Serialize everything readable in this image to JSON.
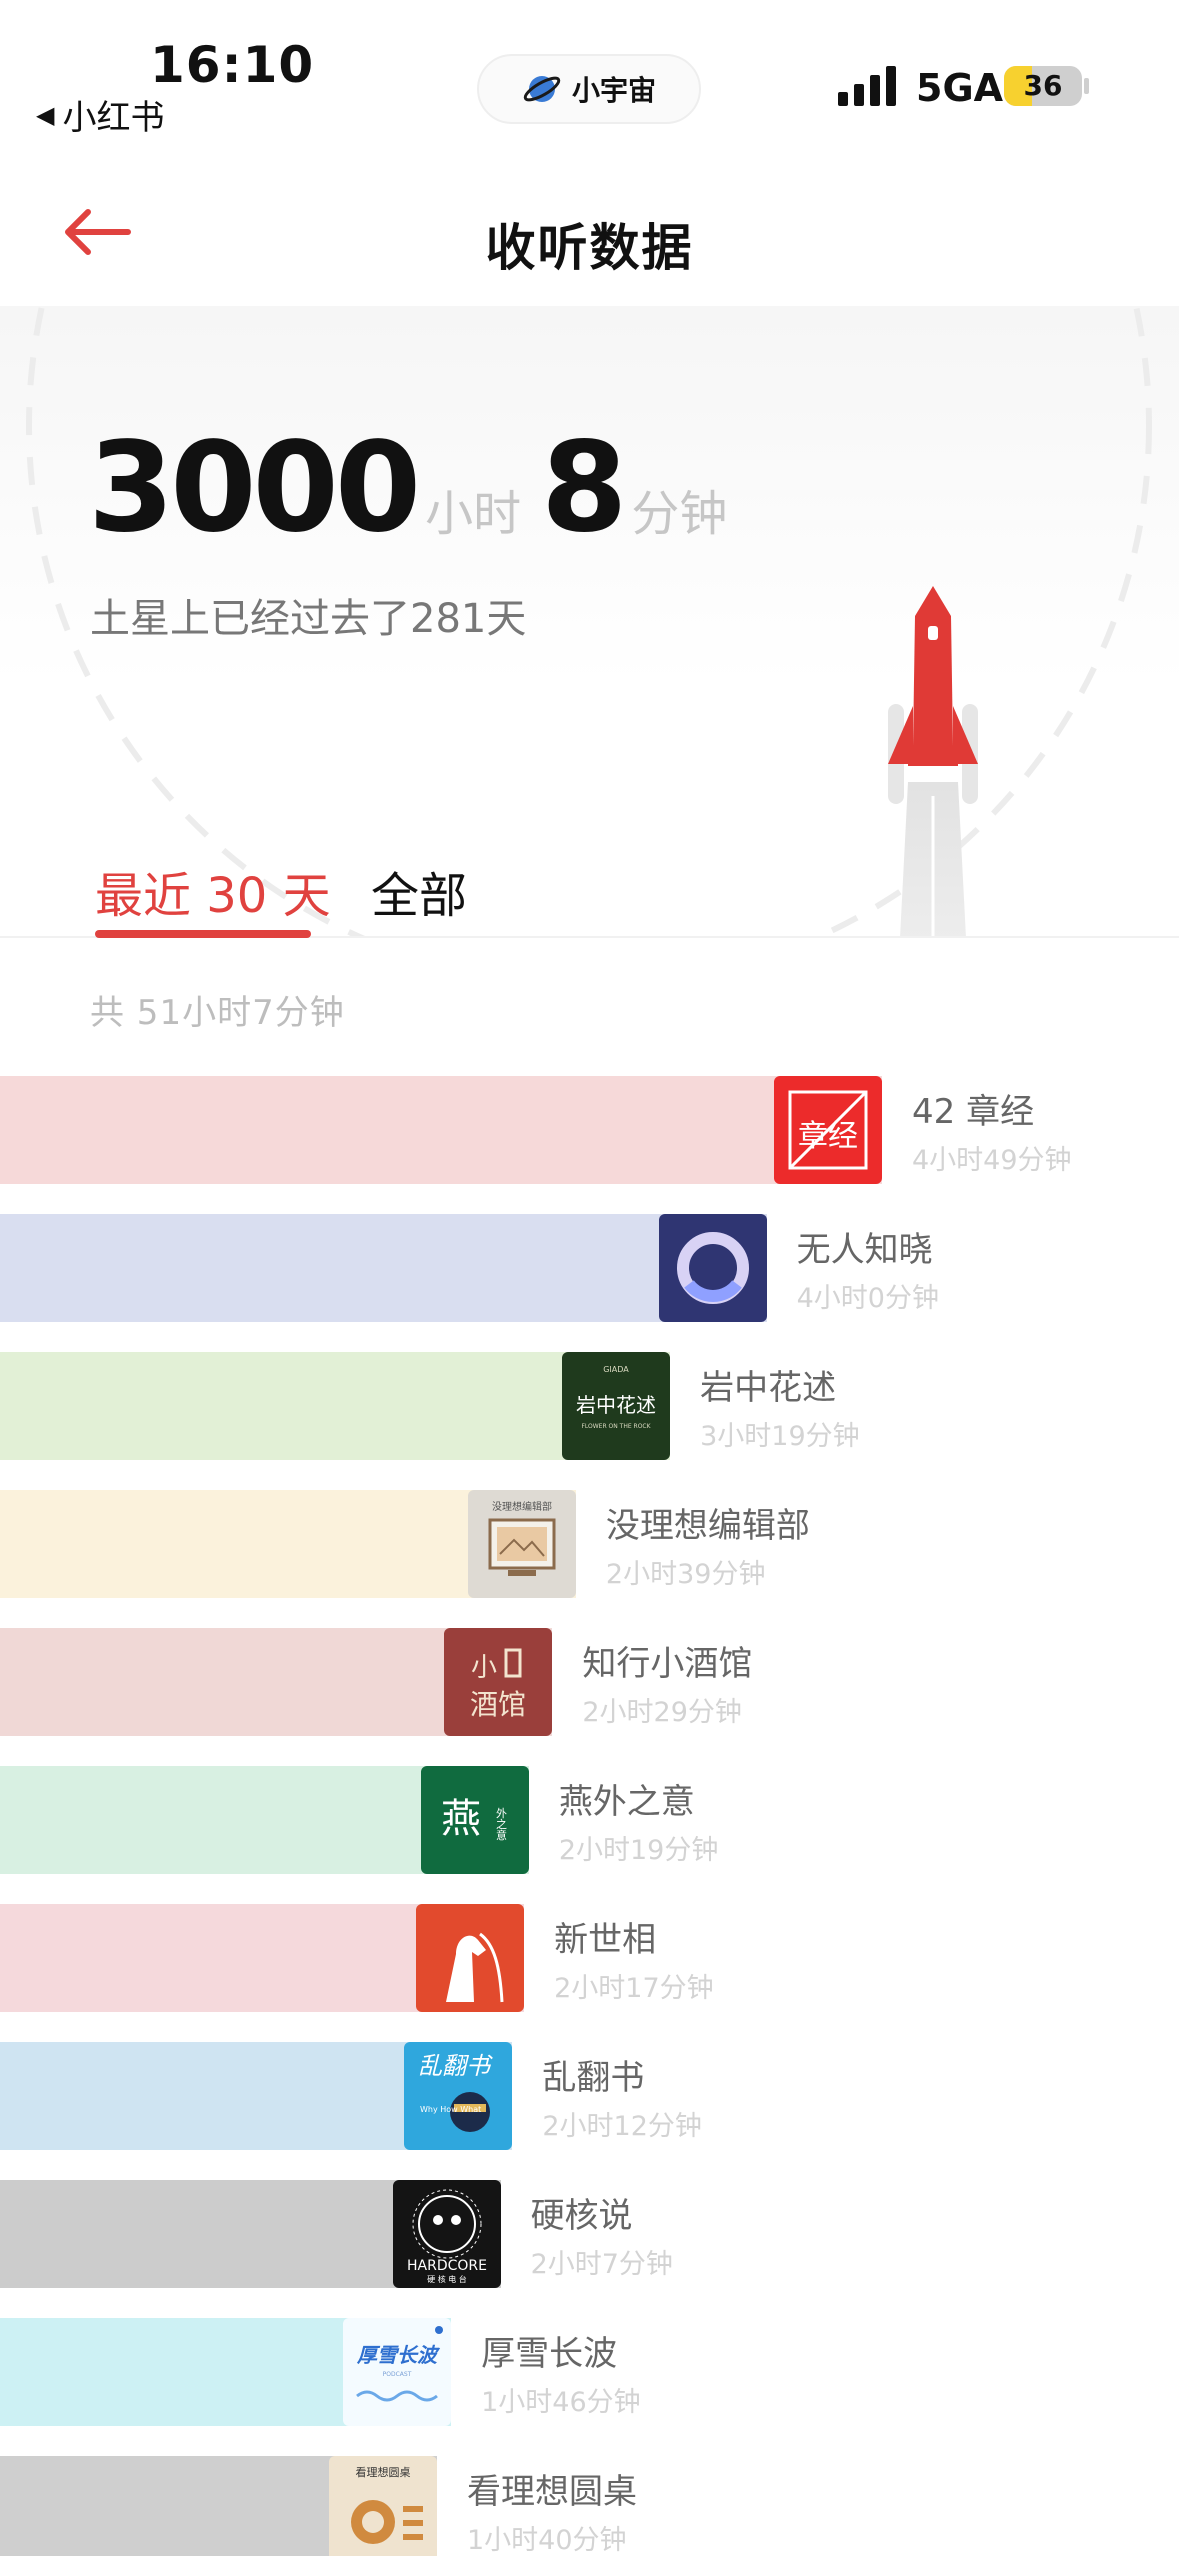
{
  "status_bar": {
    "time": "16:10",
    "back_app": "小红书",
    "center_pill": "小宇宙",
    "network": "5GA",
    "battery": "36",
    "battery_level": 0.36
  },
  "nav": {
    "title": "收听数据"
  },
  "hero": {
    "hours_value": "3000",
    "hours_unit": "小时",
    "minutes_value": "8",
    "minutes_unit": "分钟",
    "saturn_text": "土星上已经过去了281天"
  },
  "tabs": [
    {
      "label": "最近 30 天",
      "active": true
    },
    {
      "label": "全部",
      "active": false
    }
  ],
  "period_total": "共 51小时7分钟",
  "podcasts": [
    {
      "name": "42 章经",
      "duration": "4小时49分钟",
      "bar_color": "#f6d9d9",
      "minutes": 289
    },
    {
      "name": "无人知晓",
      "duration": "4小时0分钟",
      "bar_color": "#d9def0",
      "minutes": 240
    },
    {
      "name": "岩中花述",
      "duration": "3小时19分钟",
      "bar_color": "#e2f0d6",
      "minutes": 199
    },
    {
      "name": "没理想编辑部",
      "duration": "2小时39分钟",
      "bar_color": "#fbf2dc",
      "minutes": 159
    },
    {
      "name": "知行小酒馆",
      "duration": "2小时29分钟",
      "bar_color": "#f0d8d6",
      "minutes": 149
    },
    {
      "name": "燕外之意",
      "duration": "2小时19分钟",
      "bar_color": "#d8f0e2",
      "minutes": 139
    },
    {
      "name": "新世相",
      "duration": "2小时17分钟",
      "bar_color": "#f5d9dc",
      "minutes": 137
    },
    {
      "name": "乱翻书",
      "duration": "2小时12分钟",
      "bar_color": "#cfe4f2",
      "minutes": 132
    },
    {
      "name": "硬核说",
      "duration": "2小时7分钟",
      "bar_color": "#cccccc",
      "minutes": 127
    },
    {
      "name": "厚雪长波",
      "duration": "1小时46分钟",
      "bar_color": "#cdf1f4",
      "minutes": 106
    },
    {
      "name": "看理想圆桌",
      "duration": "1小时40分钟",
      "bar_color": "#cfcfcf",
      "minutes": 100
    }
  ],
  "cover_texts": {
    "c42": "章经",
    "yzhs": "岩中花述",
    "yzhs_top": "GIADA",
    "yzhs_sub": "FLOWER ON THE ROCK",
    "mlx": "没理想编辑部",
    "zxxjg_a": "小",
    "zxxjg_b": "酒馆",
    "ywzy_a": "燕",
    "ywzy_b": "外之意",
    "lfs": "乱翻书",
    "lfs_sub": "Why How What",
    "yhs": "HARDCORE",
    "yhs_sub": "硬 核 电 台",
    "hxcb": "厚雪长波",
    "hxcb_sub": "PODCAST",
    "klx": "看理想圆桌"
  },
  "colors": {
    "accent": "#e0423f",
    "rocket": "#e03a36"
  }
}
